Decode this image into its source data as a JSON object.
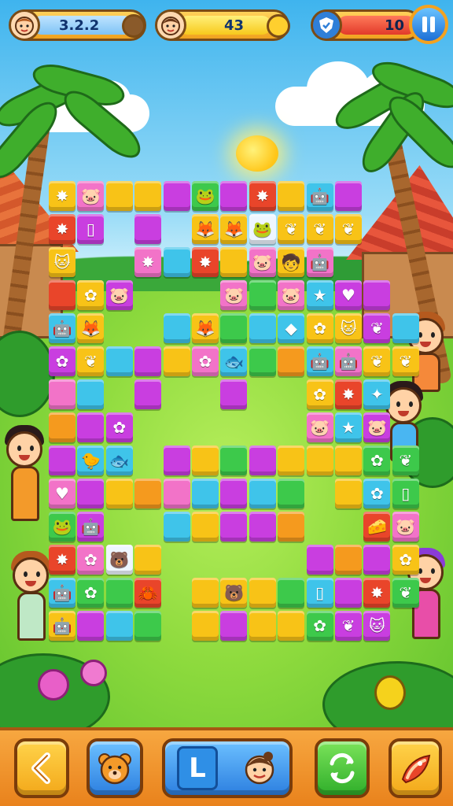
{
  "hud": {
    "player_score": "3.2.2",
    "center_value": "43",
    "right_value": "10",
    "left_avatar_icon": "boy-face-icon",
    "center_avatar_icon": "girl-face-icon",
    "right_badge_icon": "shield-badge-icon",
    "pause_icon": "pause-icon"
  },
  "bottom_bar": {
    "back_icon": "chevron-left-icon",
    "character_icon": "bear-face-icon",
    "center_letter": "L",
    "center_avatar_icon": "girl-face-icon",
    "shuffle_icon": "shuffle-arrows-icon",
    "hint_icon": "rocket-icon"
  },
  "colors": {
    "Y": "#f8c317",
    "M": "#c93ee0",
    "C": "#3fc4ea",
    "G": "#3dc94b",
    "P": "#f273c8",
    "O": "#f59a1e",
    "R": "#e9452a",
    "B": "#3b7de8",
    "W": "#eef6ff"
  },
  "glyphs": {
    "maple": "✸",
    "pig": "🐷",
    "cat": "🐱",
    "frog": "🐸",
    "fox": "🦊",
    "robot": "🤖",
    "boy": "🧒",
    "flower": "✿",
    "star": "★",
    "star4": "✦",
    "leaf": "❦",
    "bear": "🐻",
    "fish": "🐟",
    "bird": "🐤",
    "heart": "♥",
    "cheese": "🧀",
    "gem": "◆",
    "crab": "🦀",
    "ghost": "👾",
    "card": "▯"
  },
  "board": {
    "tiles": [
      "0,0,Y,maple",
      "1,0,P,pig",
      "2,0,Y,",
      "3,0,Y,",
      "4,0,M,",
      "5,0,G,frog",
      "6,0,M,",
      "7,0,R,maple",
      "8,0,Y,",
      "9,0,C,robot",
      "10,0,M,",
      "0,1,R,maple",
      "1,1,M,card",
      "3,1,M,",
      "5,1,Y,fox",
      "6,1,Y,fox",
      "7,1,W,frog",
      "8,1,Y,leaf",
      "9,1,Y,leaf",
      "10,1,Y,leaf",
      "0,2,Y,cat",
      "3,2,P,maple",
      "4,2,C,",
      "5,2,R,maple",
      "6,2,Y,",
      "7,2,P,pig",
      "8,2,Y,boy",
      "9,2,P,robot",
      "0,3,R,",
      "1,3,Y,flower",
      "2,3,M,pig",
      "6,3,P,pig",
      "7,3,G,",
      "8,3,P,pig",
      "9,3,C,star",
      "10,3,M,heart",
      "11,3,M,",
      "0,4,C,robot",
      "1,4,Y,fox",
      "4,4,C,",
      "5,4,Y,fox",
      "6,4,G,",
      "7,4,C,",
      "8,4,C,gem",
      "9,4,Y,flower",
      "10,4,Y,cat",
      "11,4,M,leaf",
      "12,4,C,",
      "0,5,M,flower",
      "1,5,Y,leaf",
      "2,5,C,",
      "3,5,M,",
      "4,5,Y,",
      "5,5,P,flower",
      "6,5,C,fish",
      "7,5,G,",
      "8,5,O,",
      "9,5,C,robot",
      "10,5,P,robot",
      "11,5,Y,leaf",
      "12,5,Y,leaf",
      "0,6,P,",
      "1,6,C,",
      "3,6,M,",
      "6,6,M,",
      "9,6,Y,flower",
      "10,6,R,maple",
      "11,6,C,star4",
      "0,7,O,",
      "1,7,M,",
      "2,7,M,flower",
      "9,7,P,pig",
      "10,7,C,star",
      "11,7,M,pig",
      "0,8,M,",
      "1,8,C,bird",
      "2,8,C,fish",
      "4,8,M,",
      "5,8,Y,",
      "6,8,G,",
      "7,8,M,",
      "8,8,Y,",
      "9,8,Y,",
      "10,8,Y,",
      "11,8,G,flower",
      "12,8,G,leaf",
      "0,9,P,heart",
      "1,9,M,",
      "2,9,Y,",
      "3,9,O,",
      "4,9,P,",
      "5,9,C,",
      "6,9,M,",
      "7,9,C,",
      "8,9,G,",
      "10,9,Y,",
      "11,9,C,flower",
      "12,9,G,card",
      "0,10,G,frog",
      "1,10,M,robot",
      "4,10,C,",
      "5,10,Y,",
      "6,10,M,",
      "7,10,M,",
      "8,10,O,",
      "11,10,R,cheese",
      "12,10,P,pig",
      "0,11,R,maple",
      "1,11,P,flower",
      "2,11,W,bear",
      "3,11,Y,",
      "9,11,M,",
      "10,11,O,",
      "11,11,M,",
      "12,11,Y,flower",
      "0,12,C,robot",
      "1,12,G,flower",
      "2,12,G,",
      "3,12,R,crab",
      "5,12,Y,",
      "6,12,Y,bear",
      "7,12,Y,",
      "8,12,G,",
      "9,12,C,card",
      "10,12,M,",
      "11,12,R,maple",
      "12,12,G,leaf",
      "0,13,Y,robot",
      "1,13,M,",
      "2,13,C,",
      "3,13,G,",
      "5,13,Y,",
      "6,13,M,",
      "7,13,Y,",
      "8,13,Y,",
      "9,13,G,flower",
      "10,13,M,leaf",
      "11,13,M,cat"
    ]
  }
}
